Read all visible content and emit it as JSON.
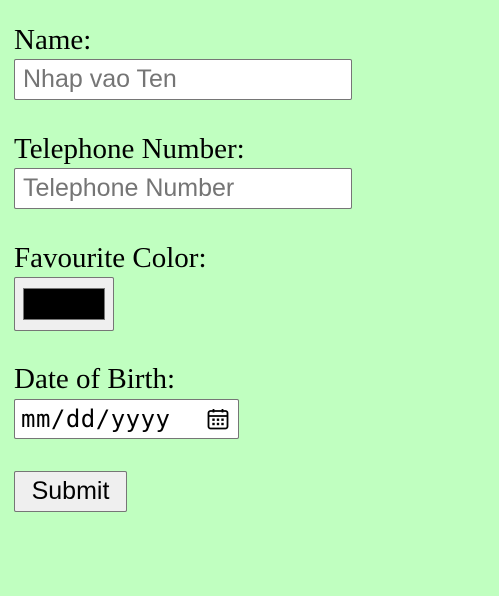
{
  "form": {
    "name": {
      "label": "Name:",
      "placeholder": "Nhap vao Ten",
      "value": ""
    },
    "telephone": {
      "label": "Telephone Number:",
      "placeholder": "Telephone Number",
      "value": ""
    },
    "favourite_color": {
      "label": "Favourite Color:",
      "value": "#000000"
    },
    "date_of_birth": {
      "label": "Date of Birth:",
      "placeholder": "mm/dd/yyyy",
      "icon": "calendar-icon"
    },
    "submit_label": "Submit"
  },
  "colors": {
    "page_background": "#c0ffc0",
    "input_border": "#767676",
    "button_background": "#efefef",
    "placeholder_text": "#757575"
  }
}
